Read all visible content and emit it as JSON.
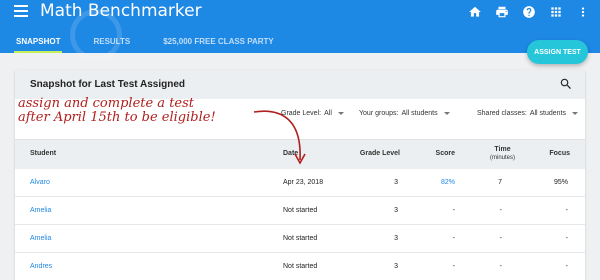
{
  "app": {
    "title": "Math Benchmarker"
  },
  "header_icons": [
    "home-icon",
    "print-icon",
    "help-icon",
    "apps-grid-icon",
    "more-vert-icon"
  ],
  "tabs": [
    {
      "label": "SNAPSHOT",
      "active": true
    },
    {
      "label": "RESULTS",
      "active": false
    },
    {
      "label": "$25,000 FREE CLASS PARTY",
      "active": false
    }
  ],
  "fab": {
    "label": "ASSIGN TEST"
  },
  "card": {
    "title": "Snapshot for Last Test Assigned"
  },
  "filters": {
    "grade": {
      "label": "Grade Level:",
      "value": "All"
    },
    "groups": {
      "label": "Your groups:",
      "value": "All students"
    },
    "shared": {
      "label": "Shared classes:",
      "value": "All students"
    }
  },
  "table": {
    "headers": {
      "student": "Student",
      "date": "Date",
      "grade": "Grade Level",
      "score": "Score",
      "time": "Time",
      "time_unit": "(minutes)",
      "focus": "Focus"
    },
    "rows": [
      {
        "student": "Alvaro",
        "date": "Apr 23, 2018",
        "grade": "3",
        "score": "82%",
        "time": "7",
        "focus": "95%"
      },
      {
        "student": "Amelia",
        "date": "Not started",
        "grade": "3",
        "score": "-",
        "time": "-",
        "focus": "-"
      },
      {
        "student": "Amelia",
        "date": "Not started",
        "grade": "3",
        "score": "-",
        "time": "-",
        "focus": "-"
      },
      {
        "student": "Andres",
        "date": "Not started",
        "grade": "3",
        "score": "-",
        "time": "-",
        "focus": "-"
      }
    ]
  },
  "annotation": {
    "line1": "assign and complete a test",
    "line2": "after April 15th to be eligible!",
    "color": "#b01e1e"
  },
  "colors": {
    "appbar": "#1e88e5",
    "tab_indicator": "#c6f05a",
    "fab": "#26c6da",
    "link": "#1e88e5"
  }
}
